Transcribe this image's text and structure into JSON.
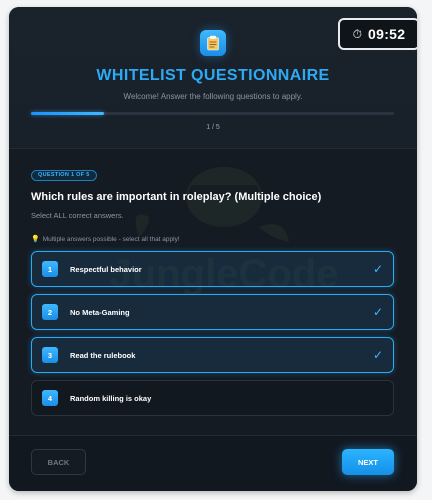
{
  "timer": {
    "value": "09:52",
    "icon": "stopwatch-icon"
  },
  "header": {
    "logo_icon": "clipboard-icon",
    "title": "WHITELIST QUESTIONNAIRE",
    "subtitle": "Welcome! Answer the following questions to apply.",
    "progress_label": "1 / 5",
    "progress_fraction": 0.2
  },
  "watermark": {
    "text": "JungleCode"
  },
  "question": {
    "badge": "QUESTION 1 OF 5",
    "text": "Which rules are important in roleplay? (Multiple choice)",
    "instruction": "Select ALL correct answers.",
    "hint_icon": "lightbulb-icon",
    "hint": "Multiple answers possible - select all that apply!"
  },
  "options": [
    {
      "number": "1",
      "label": "Respectful behavior",
      "selected": true
    },
    {
      "number": "2",
      "label": "No Meta-Gaming",
      "selected": true
    },
    {
      "number": "3",
      "label": "Read the rulebook",
      "selected": true
    },
    {
      "number": "4",
      "label": "Random killing is okay",
      "selected": false
    }
  ],
  "footer": {
    "back_label": "BACK",
    "next_label": "NEXT"
  },
  "colors": {
    "accent": "#2eaaf5",
    "background": "#151b23",
    "selected_border": "#2aaaf0"
  }
}
